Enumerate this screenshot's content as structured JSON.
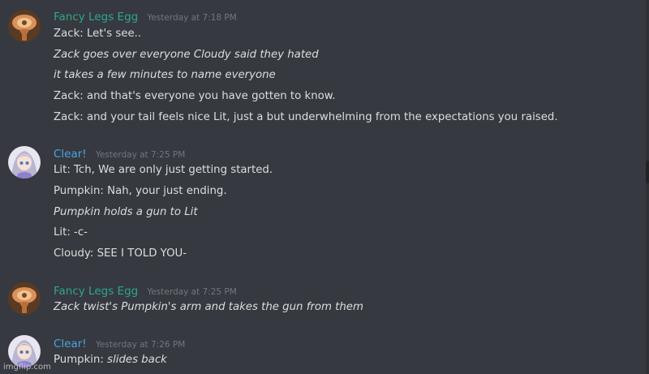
{
  "colors": {
    "background": "#36393f",
    "username_green": "#2ea68d",
    "username_blue": "#48a4e6",
    "timestamp": "#72767d",
    "text": "#dcddde"
  },
  "messages": [
    {
      "author": "Fancy Legs Egg",
      "avatar_icon": "egg-avatar-icon",
      "timestamp": "Yesterday at 7:18 PM",
      "lines": [
        {
          "text": "Zack: Let's see..",
          "italic": false
        },
        {
          "text": "Zack goes over everyone Cloudy said they hated",
          "italic": true
        },
        {
          "text": "it takes a few minutes to name everyone",
          "italic": true
        },
        {
          "text": "Zack: and that's everyone you have gotten to know.",
          "italic": false
        },
        {
          "text": "Zack: and your tail feels nice Lit, just a but underwhelming from the expectations you raised.",
          "italic": false
        }
      ]
    },
    {
      "author": "Clear!",
      "avatar_icon": "anime-girl-avatar-icon",
      "timestamp": "Yesterday at 7:25 PM",
      "lines": [
        {
          "text": "Lit: Tch, We are only just getting started.",
          "italic": false
        },
        {
          "text": "Pumpkin: Nah, your just ending.",
          "italic": false
        },
        {
          "text": "Pumpkin holds a gun to Lit",
          "italic": true
        },
        {
          "text": "Lit: -c-",
          "italic": false
        },
        {
          "text": "Cloudy: SEE I TOLD YOU-",
          "italic": false
        }
      ]
    },
    {
      "author": "Fancy Legs Egg",
      "avatar_icon": "egg-avatar-icon",
      "timestamp": "Yesterday at 7:25 PM",
      "lines": [
        {
          "text": "Zack twist's Pumpkin's arm and takes the gun from them",
          "italic": true
        }
      ]
    },
    {
      "author": "Clear!",
      "avatar_icon": "anime-girl-avatar-icon",
      "timestamp": "Yesterday at 7:26 PM",
      "lines": [
        {
          "prefix": "Pumpkin: ",
          "text": "slides back",
          "italic": true
        }
      ]
    }
  ],
  "watermark": "imgflip.com"
}
